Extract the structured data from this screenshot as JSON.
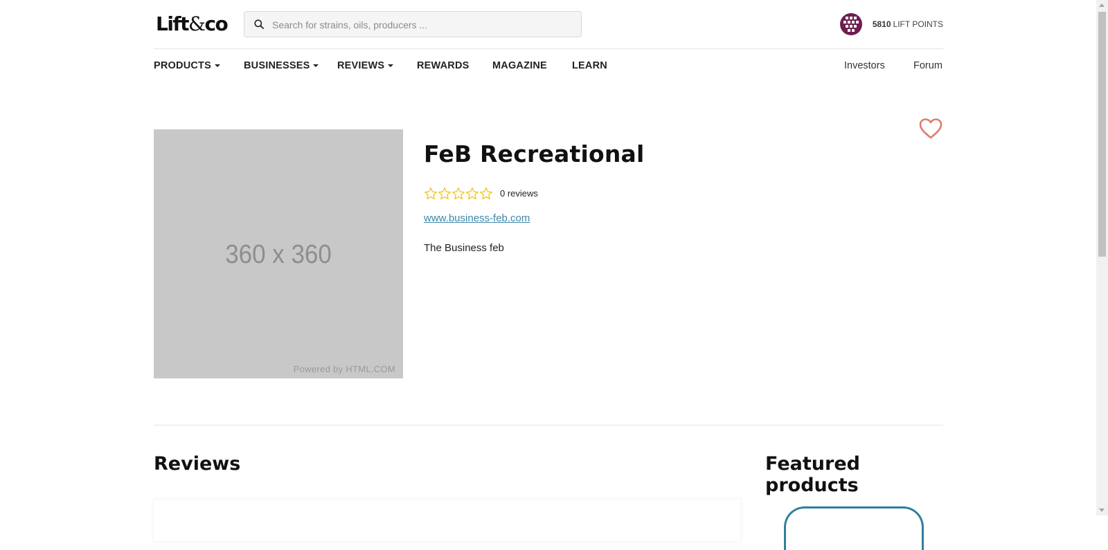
{
  "header": {
    "logo_left": "Lift",
    "logo_amp": "&",
    "logo_right": "co",
    "search_placeholder": "Search for strains, oils, producers ...",
    "points_value": "5810",
    "points_label": "LIFT POINTS",
    "avatar_color": "#6e1e4e"
  },
  "nav": {
    "products": "PRODUCTS",
    "businesses": "BUSINESSES",
    "reviews": "REVIEWS",
    "rewards": "REWARDS",
    "magazine": "MAGAZINE",
    "learn": "LEARN",
    "investors": "Investors",
    "forum": "Forum"
  },
  "business": {
    "image_placeholder": "360 x 360",
    "image_credit": "Powered by HTML.COM",
    "name": "FeB Recreational",
    "rating": 0,
    "rating_max": 5,
    "reviews_count_label": "0 reviews",
    "website": "www.business-feb.com",
    "description": "The Business feb"
  },
  "sections": {
    "reviews_title": "Reviews",
    "featured_title": "Featured products"
  },
  "colors": {
    "star": "#f5c518",
    "heart": "#e07a6a",
    "link": "#3d86a8",
    "accent": "#2f7f9c"
  }
}
